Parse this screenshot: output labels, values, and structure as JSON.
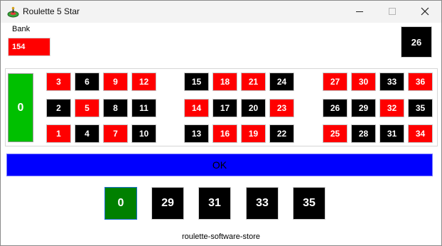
{
  "window": {
    "title": "Roulette 5 Star",
    "controls": [
      "minimize-icon",
      "maximize-icon",
      "close-icon"
    ]
  },
  "bank": {
    "label": "Bank",
    "value": "154"
  },
  "last_result": "26",
  "zero": "0",
  "colors": {
    "red": "#ff0000",
    "black": "#000000",
    "green": "#00c000",
    "ok_blue": "#0000ff",
    "history_zero_green": "#008000"
  },
  "board": {
    "rows": [
      [
        {
          "n": "3",
          "c": "red"
        },
        {
          "n": "6",
          "c": "black"
        },
        {
          "n": "9",
          "c": "red"
        },
        {
          "n": "12",
          "c": "red"
        },
        {
          "n": "15",
          "c": "black"
        },
        {
          "n": "18",
          "c": "red"
        },
        {
          "n": "21",
          "c": "red"
        },
        {
          "n": "24",
          "c": "black"
        },
        {
          "n": "27",
          "c": "red"
        },
        {
          "n": "30",
          "c": "red"
        },
        {
          "n": "33",
          "c": "black"
        },
        {
          "n": "36",
          "c": "red"
        }
      ],
      [
        {
          "n": "2",
          "c": "black"
        },
        {
          "n": "5",
          "c": "red"
        },
        {
          "n": "8",
          "c": "black"
        },
        {
          "n": "11",
          "c": "black"
        },
        {
          "n": "14",
          "c": "red"
        },
        {
          "n": "17",
          "c": "black"
        },
        {
          "n": "20",
          "c": "black"
        },
        {
          "n": "23",
          "c": "red"
        },
        {
          "n": "26",
          "c": "black"
        },
        {
          "n": "29",
          "c": "black"
        },
        {
          "n": "32",
          "c": "red"
        },
        {
          "n": "35",
          "c": "black"
        }
      ],
      [
        {
          "n": "1",
          "c": "red"
        },
        {
          "n": "4",
          "c": "black"
        },
        {
          "n": "7",
          "c": "red"
        },
        {
          "n": "10",
          "c": "black"
        },
        {
          "n": "13",
          "c": "black"
        },
        {
          "n": "16",
          "c": "red"
        },
        {
          "n": "19",
          "c": "red"
        },
        {
          "n": "22",
          "c": "black"
        },
        {
          "n": "25",
          "c": "red"
        },
        {
          "n": "28",
          "c": "black"
        },
        {
          "n": "31",
          "c": "black"
        },
        {
          "n": "34",
          "c": "red"
        }
      ]
    ]
  },
  "ok_label": "OK",
  "history": [
    {
      "n": "0",
      "c": "green"
    },
    {
      "n": "29",
      "c": "black"
    },
    {
      "n": "31",
      "c": "black"
    },
    {
      "n": "33",
      "c": "black"
    },
    {
      "n": "35",
      "c": "black"
    }
  ],
  "footer": "roulette-software-store"
}
